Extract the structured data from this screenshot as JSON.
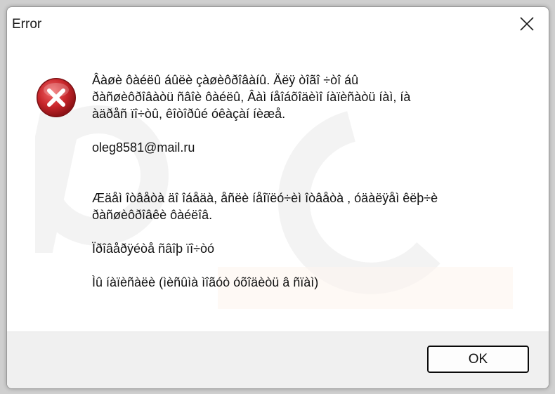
{
  "dialog": {
    "title": "Error",
    "close_icon": "close-icon",
    "error_icon": "error-icon",
    "message_lines": [
      "Âàøè ôàéëû áûëè çàøèôðîâàíû. Äëÿ òîãî ÷òî áû",
      "ðàñøèôðîâàòü ñâîè ôàéëû, Âàì íåîáõîäèìî íàïèñàòü íàì, íà",
      "àäðåñ ïî÷òû, êîòîðûé óêàçàí íèæå.",
      "",
      "oleg8581@mail.ru",
      "",
      "",
      "Æäåì îòâåòà äî îáåäà, åñëè íåîïëó÷èì îòâåòà , óäàëÿåì êëþ÷è",
      "ðàñøèôðîâêè ôàéëîâ.",
      "",
      "Ïðîâåðÿéòå ñâîþ ïî÷òó",
      "",
      "Ìû íàïèñàëè (ìèñûìà ìîãóò óõîäèòü â ñïàì)"
    ],
    "ok_label": "OK"
  },
  "colors": {
    "window_bg": "#ffffff",
    "footer_bg": "#f0f0f0",
    "error_red": "#c8262b",
    "button_border": "#0a0a0a"
  }
}
